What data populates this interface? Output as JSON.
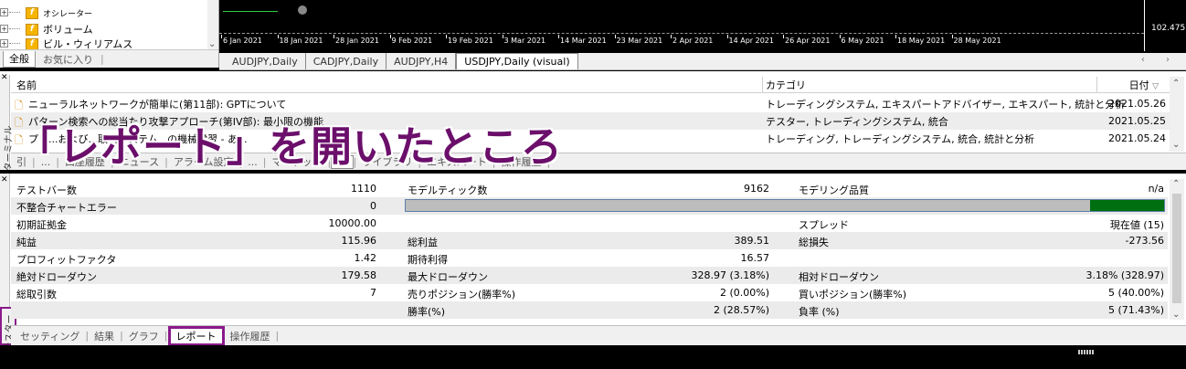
{
  "navigator": {
    "items": [
      {
        "label": "オシレーター",
        "icon": "function-icon"
      },
      {
        "label": "ボリューム",
        "icon": "function-icon"
      },
      {
        "label": "ビル・ウィリアムス",
        "icon": "function-icon"
      }
    ],
    "tabs": {
      "all": "全般",
      "favorites": "お気に入り"
    }
  },
  "chart": {
    "dates": [
      "6 Jan 2021",
      "18 Jan 2021",
      "28 Jan 2021",
      "9 Feb 2021",
      "19 Feb 2021",
      "3 Mar 2021",
      "14 Mar 2021",
      "23 Mar 2021",
      "2 Apr 2021",
      "14 Apr 2021",
      "26 Apr 2021",
      "6 May 2021",
      "18 May 2021",
      "28 May 2021"
    ],
    "price_label": "102.475",
    "tabs": [
      "AUDJPY,Daily",
      "CADJPY,Daily",
      "AUDJPY,H4",
      "USDJPY,Daily (visual)"
    ]
  },
  "terminal": {
    "side_title": "ターミナル",
    "headers": {
      "name": "名前",
      "category": "カテゴリ",
      "date": "日付"
    },
    "news": [
      {
        "title": "ニューラルネットワークが簡単に(第11部): GPTについて",
        "category": "トレーディングシステム, エキスパートアドバイザー, エキスパート, 統計と分析",
        "date": "2021.05.26"
      },
      {
        "title": "パターン検索への総当たり攻撃アプローチ(第IV部): 最小限の機能",
        "category": "テスター, トレーディングシステム, 統合",
        "date": "2021.05.25"
      },
      {
        "title": "プリ...および...取引システム...の機械学習 - あ...",
        "category": "トレーディング, トレーディングシステム, 統合, 統計と分析",
        "date": "2021.05.24"
      }
    ],
    "tabs": [
      "引",
      "...",
      "口座履歴",
      "ニュース",
      "アラーム設定",
      "...",
      "マーケット",
      "...",
      "ライブラリ",
      "エキスパート",
      "操作履歴"
    ]
  },
  "caption": "「レポート」を開いたところ",
  "tester": {
    "side_title": "テスター",
    "rows": [
      {
        "c1": "テストバー数",
        "v1": "1110",
        "c2": "モデルティック数",
        "v2": "9162",
        "c3": "モデリング品質",
        "v3": "n/a"
      },
      {
        "c1": "不整合チャートエラー",
        "v1": "0",
        "c2": "",
        "v2": "",
        "c3": "",
        "v3": ""
      },
      {
        "c1": "初期証拠金",
        "v1": "10000.00",
        "c2": "",
        "v2": "",
        "c3": "スプレッド",
        "v3": "現在値 (15)"
      },
      {
        "c1": "純益",
        "v1": "115.96",
        "c2": "総利益",
        "v2": "389.51",
        "c3": "総損失",
        "v3": "-273.56"
      },
      {
        "c1": "プロフィットファクタ",
        "v1": "1.42",
        "c2": "期待利得",
        "v2": "16.57",
        "c3": "",
        "v3": ""
      },
      {
        "c1": "絶対ドローダウン",
        "v1": "179.58",
        "c2": "最大ドローダウン",
        "v2": "328.97 (3.18%)",
        "c3": "相対ドローダウン",
        "v3": "3.18% (328.97)"
      },
      {
        "c1": "総取引数",
        "v1": "7",
        "c2": "売りポジション(勝率%)",
        "v2": "2 (0.00%)",
        "c3": "買いポジション(勝率%)",
        "v3": "5 (40.00%)"
      },
      {
        "c1": "",
        "v1": "",
        "c2": "勝率(%)",
        "v2": "2 (28.57%)",
        "c3": "負率 (%)",
        "v3": "5 (71.43%)"
      }
    ],
    "modeling_quality_fill": 0.098,
    "tabs": [
      "セッティング",
      "結果",
      "グラフ",
      "レポート",
      "操作履歴"
    ]
  }
}
